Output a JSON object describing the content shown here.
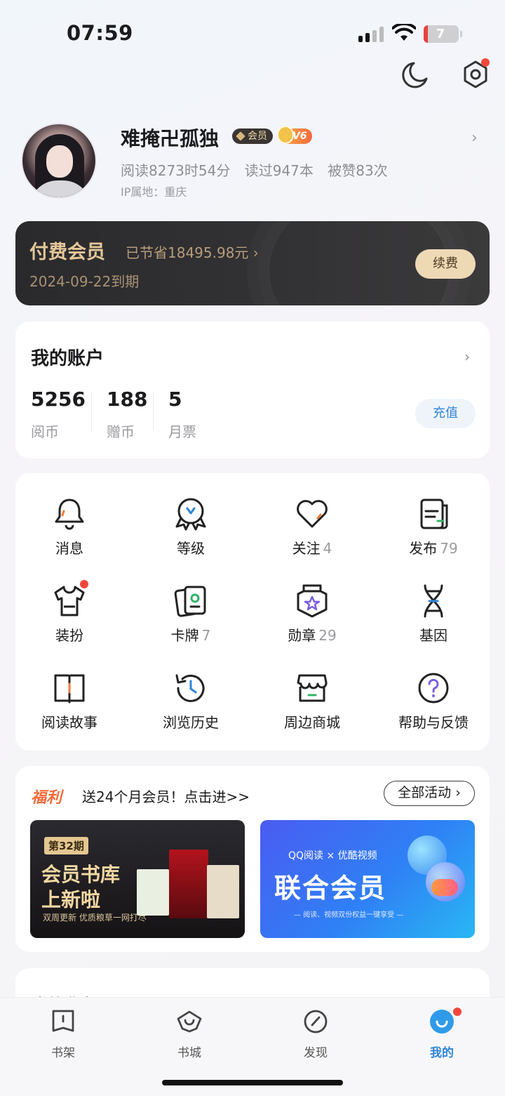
{
  "status": {
    "time": "07:59",
    "battery": "7"
  },
  "profile": {
    "username": "难掩卍孤独",
    "member_badge": "会员",
    "level_badge": "V6",
    "reading_time": "阅读8273时54分",
    "books_read": "读过947本",
    "likes": "被赞83次",
    "ip_location": "IP属地：重庆",
    "chevron": "›"
  },
  "vip": {
    "title": "付费会员",
    "saved": "已节省18495.98元 ›",
    "expiry": "2024-09-22到期",
    "renew_label": "续费"
  },
  "account": {
    "title": "我的账户",
    "chevron": "›",
    "items": [
      {
        "value": "5256",
        "label": "阅币"
      },
      {
        "value": "188",
        "label": "赠币"
      },
      {
        "value": "5",
        "label": "月票"
      }
    ],
    "recharge_label": "充值"
  },
  "grid": [
    {
      "label": "消息",
      "count": "",
      "icon": "bell-icon"
    },
    {
      "label": "等级",
      "count": "",
      "icon": "level-icon"
    },
    {
      "label": "关注",
      "count": "4",
      "icon": "heart-icon"
    },
    {
      "label": "发布",
      "count": "79",
      "icon": "publish-icon"
    },
    {
      "label": "装扮",
      "count": "",
      "icon": "tshirt-icon"
    },
    {
      "label": "卡牌",
      "count": "7",
      "icon": "cards-icon"
    },
    {
      "label": "勋章",
      "count": "29",
      "icon": "medal-icon"
    },
    {
      "label": "基因",
      "count": "",
      "icon": "dna-icon"
    },
    {
      "label": "阅读故事",
      "count": "",
      "icon": "book-icon"
    },
    {
      "label": "浏览历史",
      "count": "",
      "icon": "history-icon"
    },
    {
      "label": "周边商城",
      "count": "",
      "icon": "shop-icon"
    },
    {
      "label": "帮助与反馈",
      "count": "",
      "icon": "help-icon"
    }
  ],
  "welfare": {
    "tag": "福利",
    "text": "送24个月会员！点击进>>",
    "all_label": "全部活动 ›",
    "banner_left": {
      "issue": "第32期",
      "line1": "会员书库",
      "line2": "上新啦",
      "sub": "双周更新 优质粮草一网打尽"
    },
    "banner_right": {
      "top": "QQ阅读 × 优酷视频",
      "title": "联合会员",
      "sub": "— 阅读、视频双份权益一键享受 —"
    }
  },
  "search_peek": "书单 作家",
  "tabs": [
    {
      "label": "书架",
      "icon": "bookshelf-icon",
      "active": false
    },
    {
      "label": "书城",
      "icon": "bookstore-icon",
      "active": false
    },
    {
      "label": "发现",
      "icon": "discover-icon",
      "active": false
    },
    {
      "label": "我的",
      "icon": "me-icon",
      "active": true
    }
  ],
  "colors": {
    "accent": "#2f84d8",
    "gold": "#e5c79a",
    "notify": "#f2483c"
  }
}
